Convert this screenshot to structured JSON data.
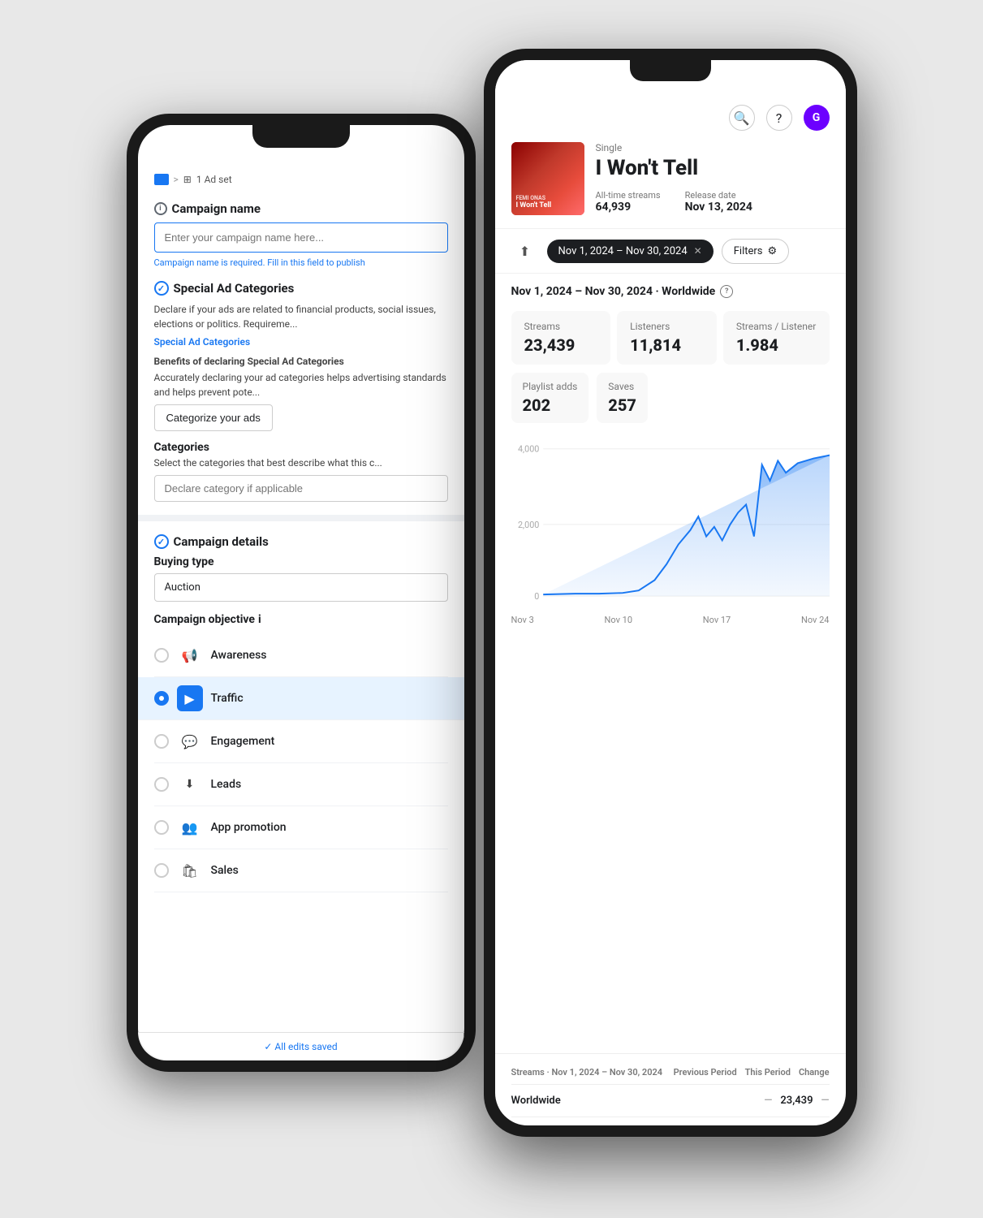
{
  "scene": {
    "bg": "#e8e8e8"
  },
  "ads_phone": {
    "breadcrumb": {
      "folder": "folder",
      "sep": ">",
      "grid": "⊞",
      "ad_sets": "1 Ad set"
    },
    "campaign_name": {
      "title": "Campaign name",
      "placeholder": "Enter your campaign name here...",
      "hint": "Campaign name is required. Fill in this field to publish"
    },
    "special_ad": {
      "title": "Special Ad Categories",
      "body": "Declare if your ads are related to financial products, social issues, elections or politics. Requireme...",
      "link": "Special Ad Categories",
      "benefits_title": "Benefits of declaring Special Ad Categories",
      "benefits_body": "Accurately declaring your ad categories helps advertising standards and helps prevent pote..."
    },
    "categorize_btn": "Categorize your ads",
    "categories": {
      "label": "Categories",
      "sub": "Select the categories that best describe what this c...",
      "placeholder": "Declare category if applicable"
    },
    "campaign_details": {
      "title": "Campaign details",
      "buying_type_label": "Buying type",
      "buying_type_value": "Auction",
      "objective_label": "Campaign objective",
      "objectives": [
        {
          "name": "Awareness",
          "icon": "📢",
          "selected": false
        },
        {
          "name": "Traffic",
          "icon": "▶",
          "selected": true
        },
        {
          "name": "Engagement",
          "icon": "💬",
          "selected": false
        },
        {
          "name": "Leads",
          "icon": "⬇",
          "selected": false
        },
        {
          "name": "App promotion",
          "icon": "👥",
          "selected": false
        },
        {
          "name": "Sales",
          "icon": "🛍",
          "selected": false
        }
      ]
    },
    "saved_bar": "✓ All edits saved"
  },
  "spotify_phone": {
    "header": {
      "search_icon": "search",
      "help_icon": "?",
      "user_initial": "G"
    },
    "track": {
      "type": "Single",
      "name": "I Won't Tell",
      "artist": "FEMI ONAS",
      "all_time_streams_label": "All-time streams",
      "all_time_streams_value": "64,939",
      "release_date_label": "Release date",
      "release_date_value": "Nov 13, 2024"
    },
    "date_filter": {
      "date_range": "Nov 1, 2024 – Nov 30, 2024",
      "filters_label": "Filters"
    },
    "period_heading": "Nov 1, 2024 – Nov 30, 2024 · Worldwide",
    "stats": {
      "streams_label": "Streams",
      "streams_value": "23,439",
      "listeners_label": "Listeners",
      "listeners_value": "11,814",
      "streams_per_listener_label": "Streams / Listener",
      "streams_per_listener_value": "1.984",
      "playlist_adds_label": "Playlist adds",
      "playlist_adds_value": "202",
      "saves_label": "Saves",
      "saves_value": "257"
    },
    "chart": {
      "y_labels": [
        "4,000",
        "2,000",
        "0"
      ],
      "x_labels": [
        "Nov 3",
        "Nov 10",
        "Nov 17",
        "Nov 24"
      ],
      "accent_color": "#1877f2"
    },
    "table": {
      "header": [
        "Streams · Nov 1, 2024 – Nov 30, 2024",
        "Previous Period",
        "This Period",
        "Change"
      ],
      "rows": [
        {
          "label": "Worldwide",
          "prev": "—",
          "current": "23,439",
          "change": "—"
        }
      ]
    }
  }
}
